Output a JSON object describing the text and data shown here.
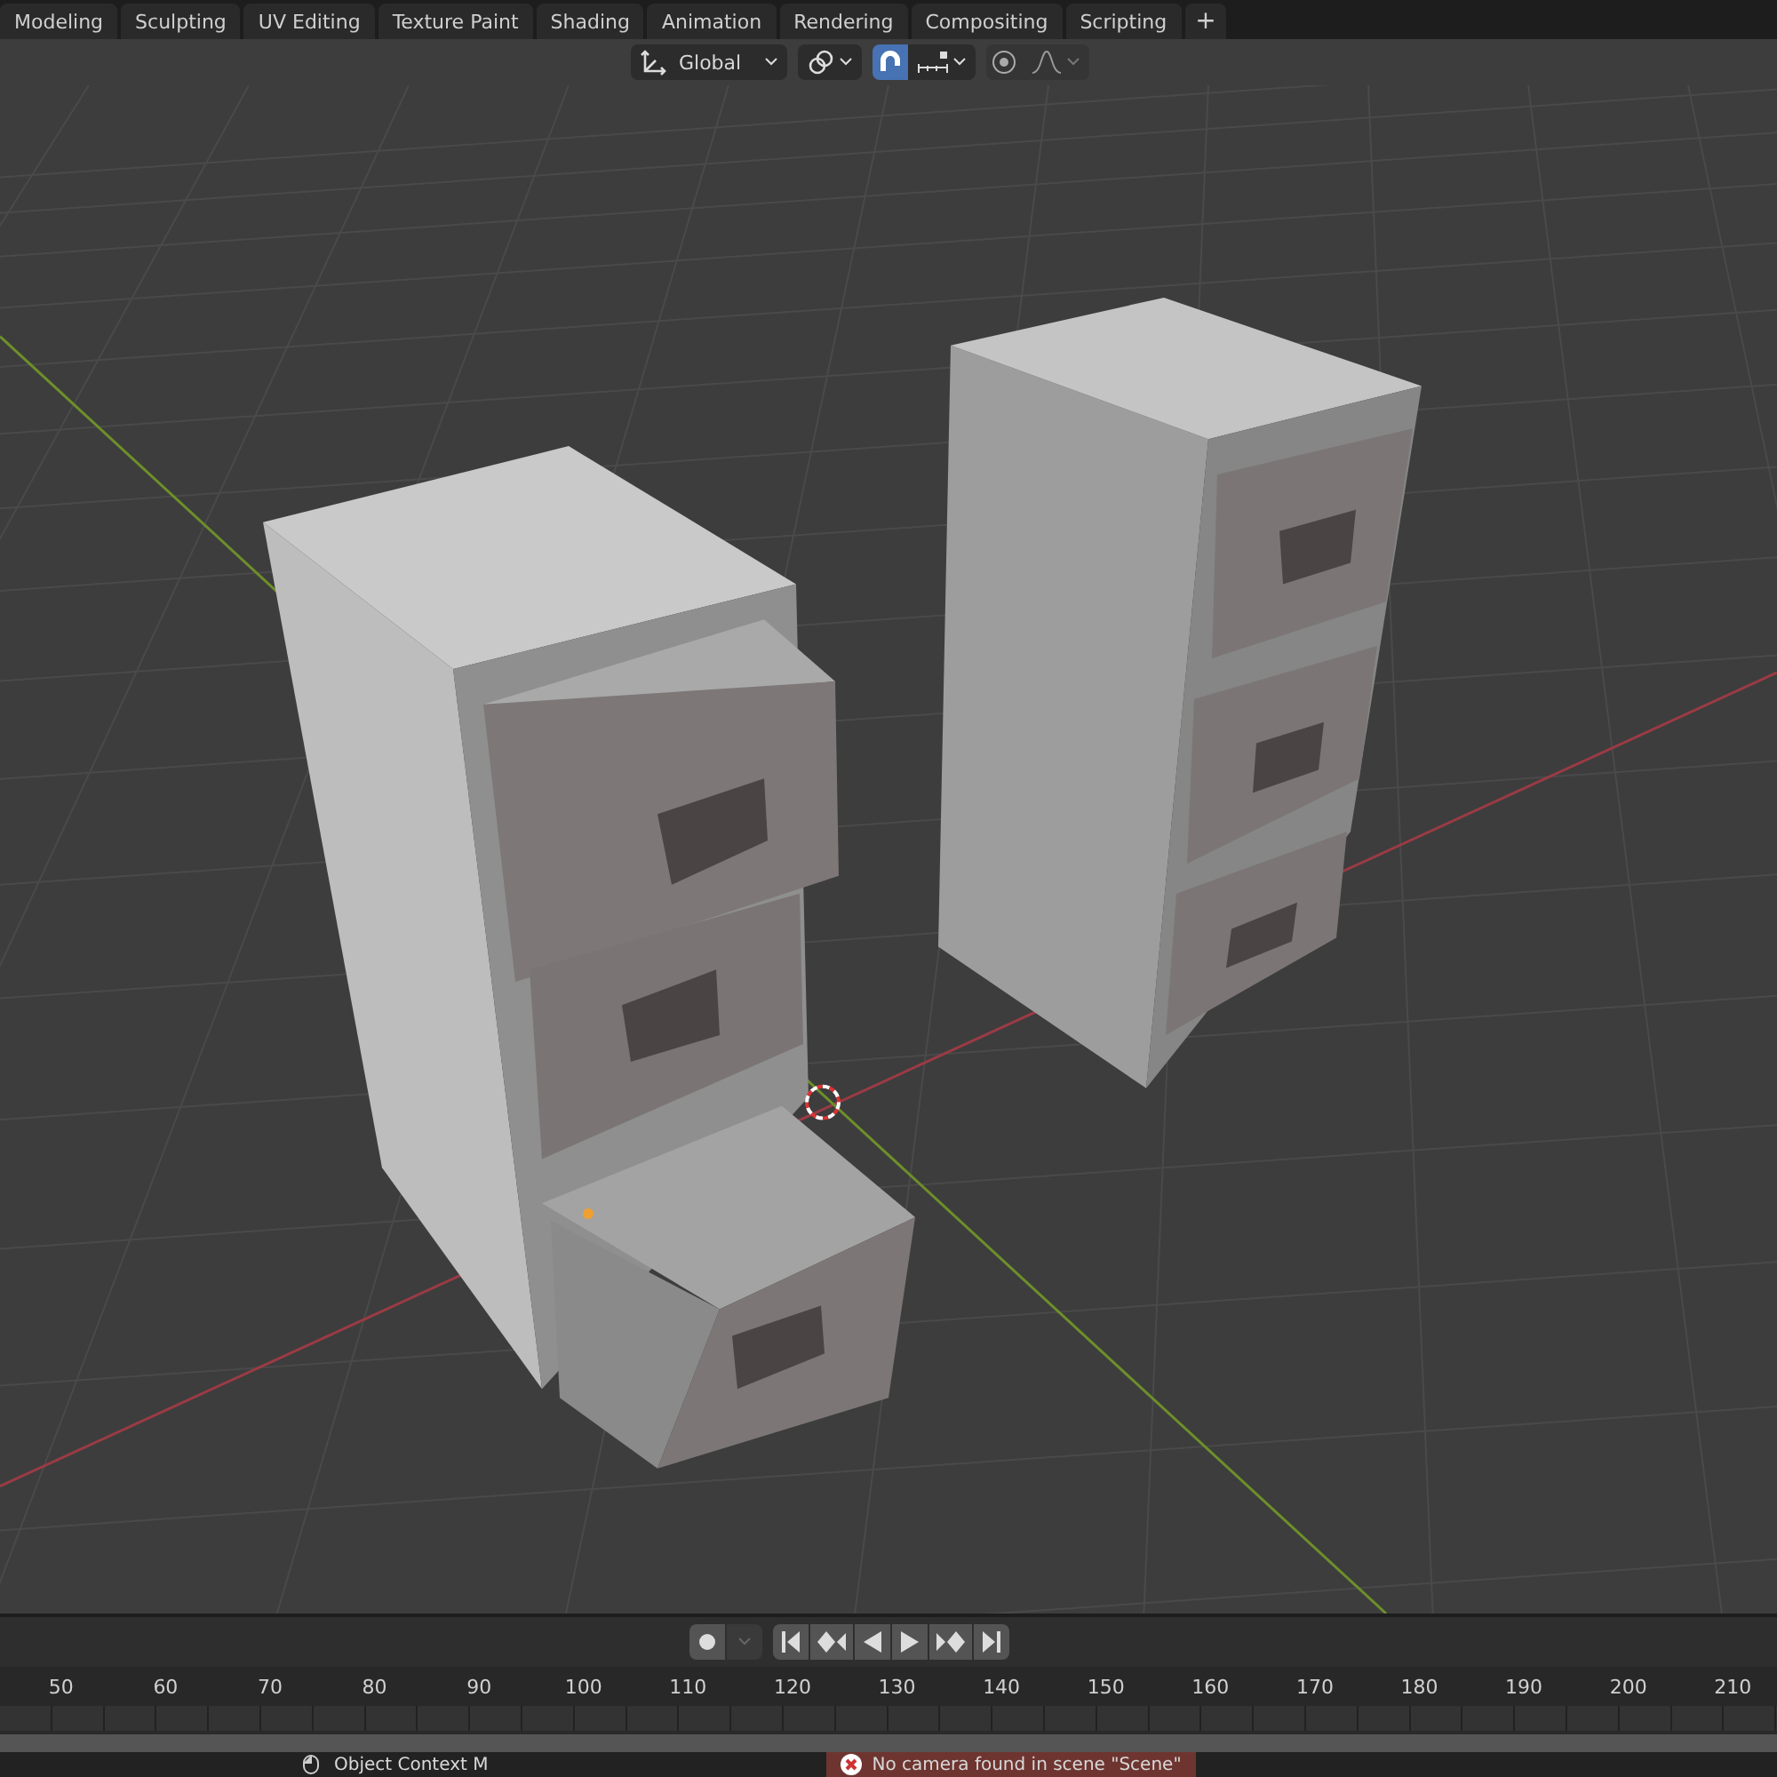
{
  "workspace_tabs": [
    {
      "label": "Modeling",
      "selected": false
    },
    {
      "label": "Sculpting",
      "selected": false
    },
    {
      "label": "UV Editing",
      "selected": false
    },
    {
      "label": "Texture Paint",
      "selected": false
    },
    {
      "label": "Shading",
      "selected": false
    },
    {
      "label": "Animation",
      "selected": false
    },
    {
      "label": "Rendering",
      "selected": false
    },
    {
      "label": "Compositing",
      "selected": false
    },
    {
      "label": "Scripting",
      "selected": false
    }
  ],
  "add_tab_label": "+",
  "header": {
    "transform_orientation": "Global",
    "snap_on": true,
    "proportional_editing_on": false
  },
  "timeline": {
    "auto_keying_on": false,
    "frame_labels": [
      "50",
      "60",
      "70",
      "80",
      "90",
      "100",
      "110",
      "120",
      "130",
      "140",
      "150",
      "160",
      "170",
      "180",
      "190",
      "200",
      "210"
    ]
  },
  "status_bar": {
    "hint": "Object Context M",
    "error": "No camera found in scene \"Scene\""
  }
}
